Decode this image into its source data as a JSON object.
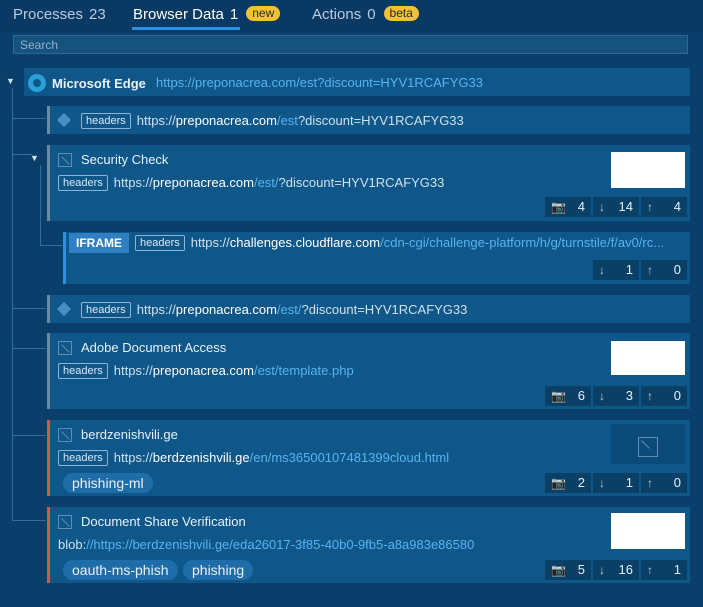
{
  "tabs": [
    {
      "label": "Processes",
      "count": "23"
    },
    {
      "label": "Browser Data",
      "count": "1",
      "badge": "new"
    },
    {
      "label": "Actions",
      "count": "0",
      "badge": "beta"
    }
  ],
  "search": {
    "placeholder": "Search"
  },
  "root": {
    "name": "Microsoft Edge",
    "url": "https://preponacrea.com/est?discount=HYV1RCAFYG33"
  },
  "nodes": [
    {
      "header": "headers",
      "scheme": "https://",
      "host": "preponacrea.com",
      "path": "/est",
      "query": "?discount=HYV1RCAFYG33"
    },
    {
      "title": "Security Check",
      "header": "headers",
      "scheme": "https://",
      "host": "preponacrea.com",
      "path": "/est/",
      "query": "?discount=HYV1RCAFYG33",
      "stats": [
        "4",
        "14",
        "4"
      ]
    },
    {
      "label": "IFRAME",
      "header": "headers",
      "scheme": "https://",
      "host": "challenges.cloudflare.com",
      "path": "/cdn-cgi/challenge-platform/h/g/turnstile/f/av0/rc...",
      "stats": [
        "1",
        "0"
      ]
    },
    {
      "header": "headers",
      "scheme": "https://",
      "host": "preponacrea.com",
      "path": "/est/",
      "query": "?discount=HYV1RCAFYG33"
    },
    {
      "title": "Adobe Document Access",
      "header": "headers",
      "scheme": "https://",
      "host": "preponacrea.com",
      "path": "/est/template.php",
      "stats": [
        "6",
        "3",
        "0"
      ]
    },
    {
      "title": "berdzenishvili.ge",
      "header": "headers",
      "scheme": "https://",
      "host": "berdzenishvili.ge",
      "path": "/en/ms36500107481399cloud.html",
      "tags": [
        "phishing-ml"
      ],
      "stats": [
        "2",
        "1",
        "0"
      ]
    },
    {
      "title": "Document Share Verification",
      "scheme": "blob:",
      "host": "//https://berdzenishvili.ge/eda26017-3f85-40b0-9fb5-a8a983e86580",
      "tags": [
        "oauth-ms-phish",
        "phishing"
      ],
      "stats": [
        "5",
        "16",
        "1"
      ]
    }
  ]
}
